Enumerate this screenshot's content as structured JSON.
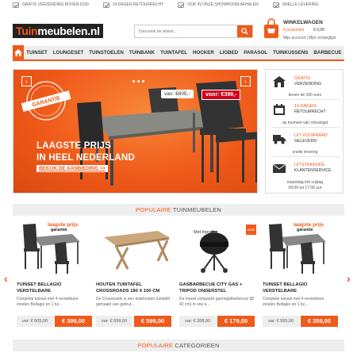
{
  "topbar": {
    "items": [
      "GRATIS VERZENDING BOVEN €150",
      "14 DAGEN RETOURRECHT",
      "OOK IN ONZE SHOWROOM AFHALEN",
      "SNELLE LEVERING"
    ]
  },
  "header": {
    "logo_main": "Tuin",
    "logo_rest": "meubelen.nl",
    "search_placeholder": "Doorzoek de winkel...",
    "cart_title": "WINKELWAGEN",
    "cart_count": "0 producten",
    "cart_amount": "€ 0,00",
    "cart_links": "Mijn account | Mijn verlanglijst"
  },
  "nav": {
    "items": [
      "TUINSET",
      "LOUNGESET",
      "TUINSTOELEN",
      "TUINBANK",
      "TUINTAFEL",
      "HOCKER",
      "LIGBED",
      "PARASOL",
      "TUINKUSSENS",
      "BARBECUE"
    ]
  },
  "hero": {
    "stamp_text": "laagste prijs GARANTIE",
    "price_old": "van: €605,-",
    "price_new": "voor: €399,-",
    "line1": "LAAGSTE PRIJS",
    "line2": "IN HEEL NEDERLAND",
    "cta": "BEKIJK DE AANBIEDING >>"
  },
  "usp": [
    {
      "l1": "GRATIS",
      "l2": "VERZENDING",
      "sub": "boven de 150 euro",
      "icon": "house-icon"
    },
    {
      "l1": "14 DAGEN",
      "l2": "RETOURRECHT",
      "sub": "op moment van ontvangst",
      "icon": "calendar-icon"
    },
    {
      "l1": "UIT VOORRAAD",
      "l2": "GELEVERD",
      "sub": "snelle levering",
      "icon": "truck-icon"
    },
    {
      "l1": "UITSTEKENDE",
      "l2": "KLANTENSERVICE",
      "sub": "maandag t/m vrijdag",
      "sub2": "09:00 tot 17:00 uur",
      "icon": "mail-icon"
    }
  ],
  "sections": {
    "popular_products_hl": "POPULAIRE",
    "popular_products_rest": " TUINMEUBELEN",
    "popular_categories_hl": "POPULAIRE",
    "popular_categories_rest": " CATEGORIEEN"
  },
  "badges": {
    "laagste": "laagste prijs",
    "garantie": "garantie",
    "tripod": "Met tripod!",
    "actie": "actie"
  },
  "products": [
    {
      "name": "TUINSET BELLAGIO VERSTELBARE",
      "desc": "Complete tuinset met 4 verstelbare stoelen Bellagio en 1 tui...",
      "old": "var: € 605,00",
      "new": "€ 399,00"
    },
    {
      "name": "HOUTEN TUINTAFEL CROSSROADS 180 X 100 CM",
      "desc": "De Crossroads is een teakhouten tuintafel gemaakt van gebrui...",
      "old": "var: € 699,00",
      "new": "€ 599,00"
    },
    {
      "name": "GASBARBECUE CITY GAS + TRIPOD ONDERSTEL",
      "desc": "De meest compacte gasrolgelbarbecue (Ø 42 cm) in one a ...",
      "old": "var: € 208,90",
      "new": "€ 179,00"
    },
    {
      "name": "TUINSET BELLAGIO VERSTELBARE",
      "desc": "Complete tuinset met 4 verstelbare stoelen Bellagio en 1 tui...",
      "old": "var: € 555,00",
      "new": "€ 359,00"
    }
  ],
  "colors": {
    "accent": "#f05a1a",
    "dark": "#222222",
    "nav_bg": "#ededed"
  }
}
